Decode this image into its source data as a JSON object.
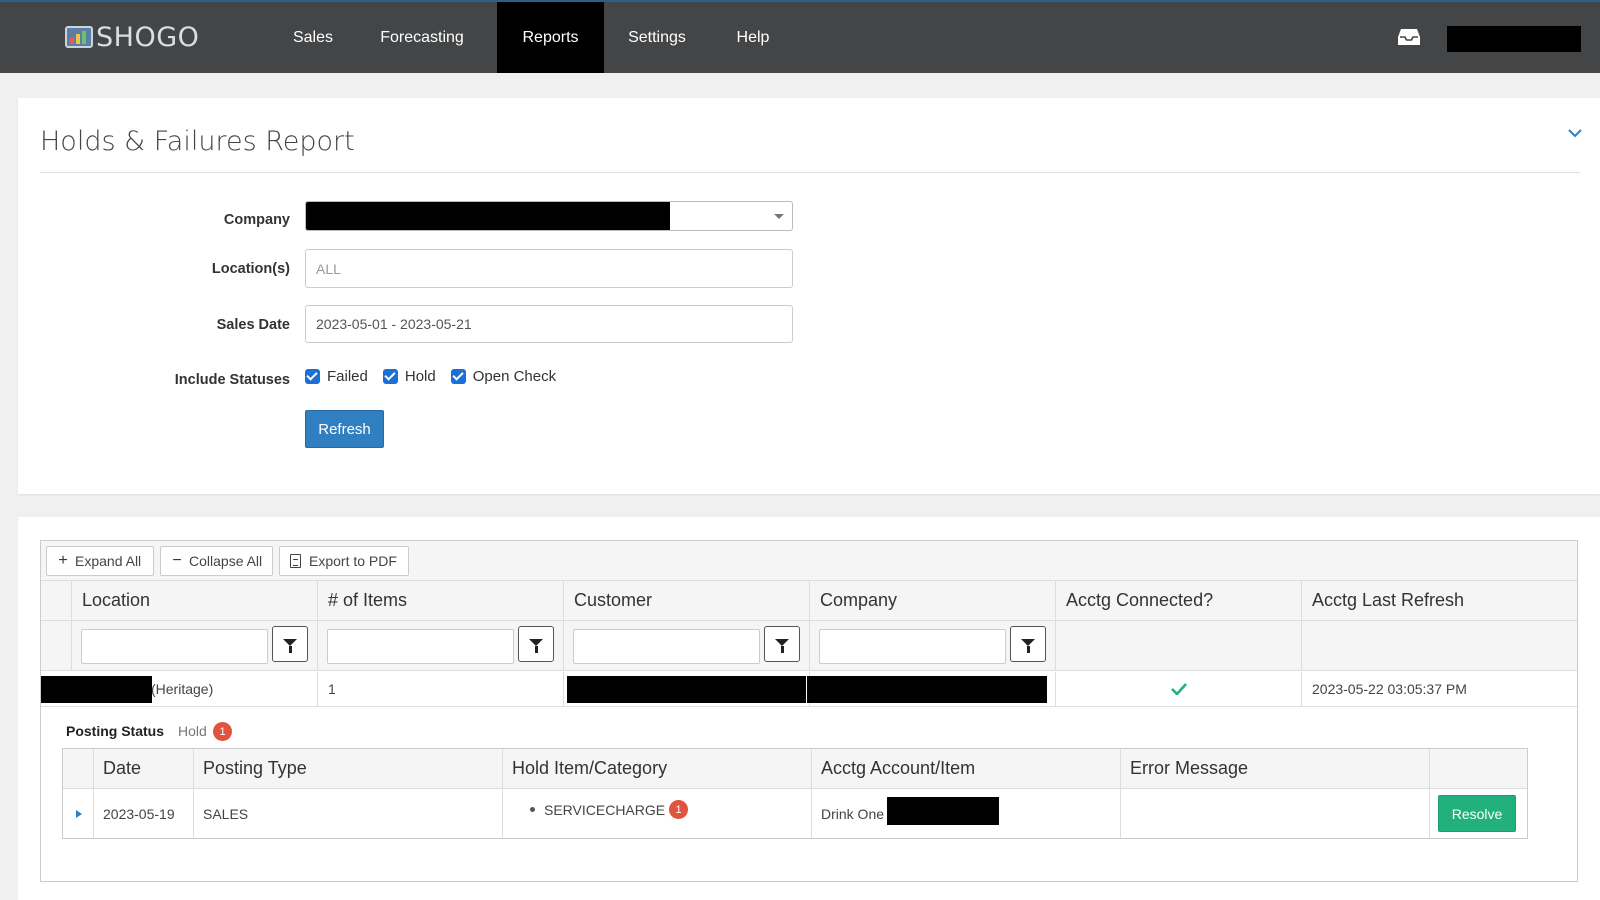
{
  "app": {
    "logo_text": "SHOGO",
    "nav": [
      {
        "label": "Sales",
        "active": false
      },
      {
        "label": "Forecasting",
        "active": false
      },
      {
        "label": "Reports",
        "active": true
      },
      {
        "label": "Settings",
        "active": false
      },
      {
        "label": "Help",
        "active": false
      }
    ],
    "icons": {
      "inbox": "inbox-icon"
    }
  },
  "report": {
    "title": "Holds & Failures Report",
    "form": {
      "company_label": "Company",
      "locations_label": "Location(s)",
      "locations_placeholder": "ALL",
      "sales_date_label": "Sales Date",
      "sales_date_value": "2023-05-01 - 2023-05-21",
      "statuses_label": "Include Statuses",
      "statuses": [
        {
          "label": "Failed",
          "checked": true
        },
        {
          "label": "Hold",
          "checked": true
        },
        {
          "label": "Open Check",
          "checked": true
        }
      ],
      "refresh_label": "Refresh"
    }
  },
  "grid": {
    "toolbar": {
      "expand_all": "Expand All",
      "collapse_all": "Collapse All",
      "export_pdf": "Export to PDF"
    },
    "columns": [
      "Location",
      "# of Items",
      "Customer",
      "Company",
      "Acctg Connected?",
      "Acctg Last Refresh"
    ],
    "row": {
      "location_suffix": "(Heritage)",
      "items": "1",
      "acctg_connected": true,
      "acctg_last_refresh": "2023-05-22 03:05:37 PM"
    },
    "detail": {
      "posting_status_label": "Posting Status",
      "posting_status_value": "Hold",
      "posting_status_count": "1",
      "columns": [
        "Date",
        "Posting Type",
        "Hold Item/Category",
        "Acctg Account/Item",
        "Error Message"
      ],
      "row": {
        "date": "2023-05-19",
        "posting_type": "SALES",
        "hold_item": "SERVICECHARGE",
        "hold_item_count": "1",
        "acctg_account": "Drink One",
        "error_message": "",
        "resolve_label": "Resolve"
      }
    }
  },
  "colors": {
    "navbar": "#444547",
    "nav_active": "#000000",
    "primary_button": "#2f7fc1",
    "resolve_button": "#22b07d",
    "badge": "#e0533f",
    "checkbox": "#1a6fd9",
    "check_green": "#22b07d"
  }
}
